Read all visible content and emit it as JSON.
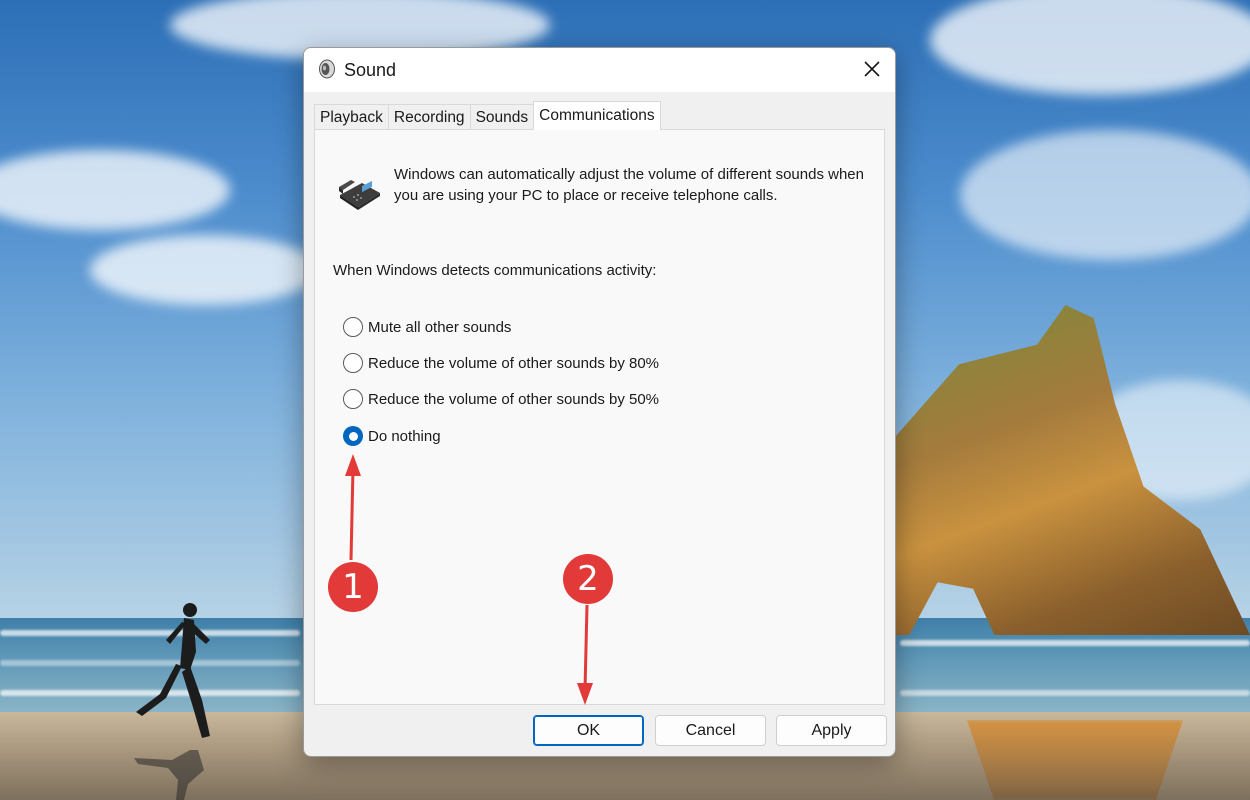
{
  "dialog": {
    "title": "Sound",
    "tabs": [
      {
        "label": "Playback",
        "active": false
      },
      {
        "label": "Recording",
        "active": false
      },
      {
        "label": "Sounds",
        "active": false
      },
      {
        "label": "Communications",
        "active": true
      }
    ],
    "description": "Windows can automatically adjust the volume of different sounds when you are using your PC to place or receive telephone calls.",
    "detect_label": "When Windows detects communications activity:",
    "options": [
      {
        "label": "Mute all other sounds",
        "checked": false
      },
      {
        "label": "Reduce the volume of other sounds by 80%",
        "checked": false
      },
      {
        "label": "Reduce the volume of other sounds by 50%",
        "checked": false
      },
      {
        "label": "Do nothing",
        "checked": true
      }
    ],
    "buttons": {
      "ok": "OK",
      "cancel": "Cancel",
      "apply": "Apply"
    }
  },
  "annotations": {
    "badge_1": "1",
    "badge_2": "2",
    "color": "#e23a38"
  },
  "colors": {
    "accent": "#0067c0"
  },
  "icons": {
    "title": "speaker-icon",
    "close": "close-icon",
    "panel": "telephone-icon"
  }
}
